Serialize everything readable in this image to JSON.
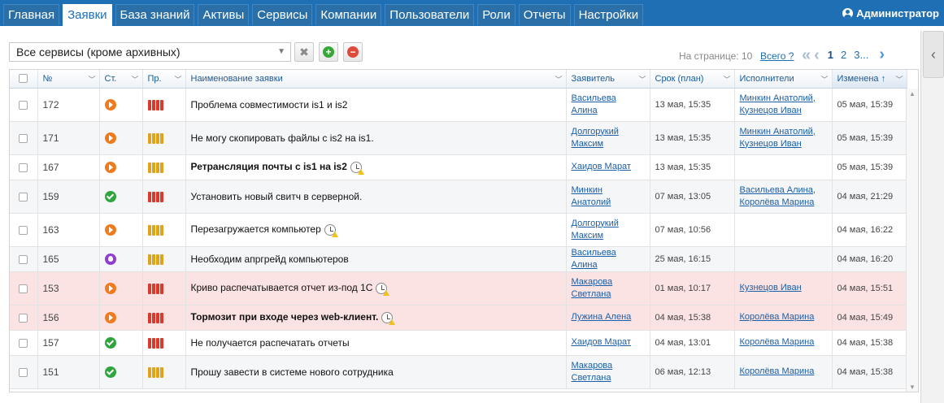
{
  "nav": {
    "tabs": [
      {
        "label": "Главная"
      },
      {
        "label": "Заявки"
      },
      {
        "label": "База знаний"
      },
      {
        "label": "Активы"
      },
      {
        "label": "Сервисы"
      },
      {
        "label": "Компании"
      },
      {
        "label": "Пользователи"
      },
      {
        "label": "Роли"
      },
      {
        "label": "Отчеты"
      },
      {
        "label": "Настройки"
      }
    ],
    "active_tab": "Заявки",
    "user": "Администратор"
  },
  "toolbar": {
    "service_filter": "Все сервисы (кроме архивных)",
    "per_page_label": "На странице: 10",
    "total_label": "Всего ?",
    "pages": [
      "1",
      "2",
      "3..."
    ],
    "current_page": "1"
  },
  "table": {
    "columns": {
      "num": "№",
      "status": "Ст.",
      "priority": "Пр.",
      "title": "Наименование заявки",
      "requester": "Заявитель",
      "due": "Срок (план)",
      "assignees": "Исполнители",
      "changed": "Изменена ↑"
    },
    "rows": [
      {
        "num": "172",
        "status": "orange",
        "status_icon": "in-progress-icon",
        "priority": "red",
        "title": "Проблема совместимости is1 и is2",
        "bold": false,
        "clock": false,
        "requester": "Васильева Алина",
        "due": "13 мая, 15:35",
        "assignees": [
          "Минкин Анатолий,",
          "Кузнецов Иван"
        ],
        "changed": "05 мая, 15:39",
        "highlight": "none"
      },
      {
        "num": "171",
        "status": "orange",
        "status_icon": "in-progress-icon",
        "priority": "yellow",
        "title": "Не могу скопировать файлы с is2 на is1.",
        "bold": false,
        "clock": false,
        "requester": "Долгорукий Максим",
        "due": "13 мая, 15:35",
        "assignees": [
          "Минкин Анатолий,",
          "Кузнецов Иван"
        ],
        "changed": "05 мая, 15:39",
        "highlight": "alt"
      },
      {
        "num": "167",
        "status": "orange",
        "status_icon": "in-progress-icon",
        "priority": "yellow",
        "title": "Ретрансляция почты с is1 на is2",
        "bold": true,
        "clock": true,
        "requester": "Хаидов Марат",
        "due": "13 мая, 15:35",
        "assignees": [],
        "changed": "05 мая, 15:39",
        "highlight": "none"
      },
      {
        "num": "159",
        "status": "green",
        "status_icon": "done-icon",
        "priority": "red",
        "title": "Установить новый свитч в серверной.",
        "bold": false,
        "clock": false,
        "requester": "Минкин Анатолий",
        "due": "07 мая, 13:05",
        "assignees": [
          "Васильева Алина,",
          "Королёва Марина"
        ],
        "changed": "04 мая, 21:29",
        "highlight": "alt"
      },
      {
        "num": "163",
        "status": "orange",
        "status_icon": "in-progress-icon",
        "priority": "yellow",
        "title": "Перезагружается компьютер",
        "bold": false,
        "clock": true,
        "requester": "Долгорукий Максим",
        "due": "07 мая, 10:56",
        "assignees": [],
        "changed": "04 мая, 16:22",
        "highlight": "none"
      },
      {
        "num": "165",
        "status": "purple",
        "status_icon": "waiting-icon",
        "priority": "yellow",
        "title": "Необходим апргрейд компьютеров",
        "bold": false,
        "clock": false,
        "requester": "Васильева Алина",
        "due": "25 мая, 16:15",
        "assignees": [],
        "changed": "04 мая, 16:20",
        "highlight": "alt"
      },
      {
        "num": "153",
        "status": "orange",
        "status_icon": "in-progress-icon",
        "priority": "red",
        "title": "Криво распечатывается отчет из-под 1С",
        "bold": false,
        "clock": true,
        "requester": "Макарова Светлана",
        "due": "01 мая, 10:17",
        "assignees": [
          "Кузнецов Иван"
        ],
        "changed": "04 мая, 15:51",
        "highlight": "pink"
      },
      {
        "num": "156",
        "status": "orange",
        "status_icon": "in-progress-icon",
        "priority": "red",
        "title": "Тормозит при входе через web-клиент.",
        "bold": true,
        "clock": true,
        "requester": "Лужина Алена",
        "due": "04 мая, 15:38",
        "assignees": [
          "Королёва Марина"
        ],
        "changed": "04 мая, 15:49",
        "highlight": "pink"
      },
      {
        "num": "157",
        "status": "green",
        "status_icon": "done-icon",
        "priority": "red",
        "title": "Не получается распечатать отчеты",
        "bold": false,
        "clock": false,
        "requester": "Хаидов Марат",
        "due": "04 мая, 13:01",
        "assignees": [
          "Королёва Марина"
        ],
        "changed": "04 мая, 15:38",
        "highlight": "none"
      },
      {
        "num": "151",
        "status": "green",
        "status_icon": "done-icon",
        "priority": "yellow",
        "title": "Прошу завести в системе нового сотрудника",
        "bold": false,
        "clock": false,
        "requester": "Макарова Светлана",
        "due": "06 мая, 12:13",
        "assignees": [
          "Королёва Марина"
        ],
        "changed": "04 мая, 15:38",
        "highlight": "alt"
      }
    ]
  },
  "colors": {
    "nav_bg": "#1f6fb5",
    "link": "#1a5fa8",
    "overdue_row": "#fbe3e3",
    "status_in_progress": "#f07b1d",
    "status_done": "#2fa540",
    "status_waiting": "#8e3fd1",
    "priority_high": "#d93a2b",
    "priority_medium": "#e0a41a"
  }
}
